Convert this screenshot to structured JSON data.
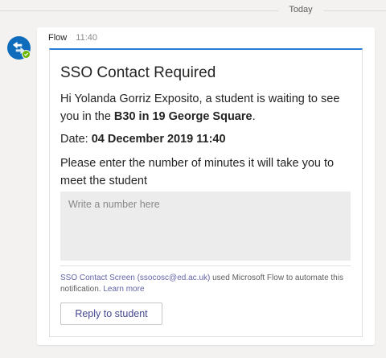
{
  "divider": {
    "label": "Today"
  },
  "message": {
    "sender": "Flow",
    "time": "11:40"
  },
  "card": {
    "title": "SSO Contact Required",
    "body_prefix": "Hi Yolanda Gorriz Exposito, a student is waiting to see you in the ",
    "body_location": "B30 in 19 George Square",
    "body_suffix": ".",
    "date_label": "Date: ",
    "date_value": "04 December 2019 11:40",
    "prompt": "Please enter the number of minutes it will take you to meet the student",
    "input_placeholder": "Write a number here",
    "footer_sender": "SSO Contact Screen (ssocosc@ed.ac.uk)",
    "footer_text": " used Microsoft Flow to automate this notification. ",
    "footer_link": "Learn more",
    "button_label": "Reply to student"
  },
  "colors": {
    "accent": "#2b7cd3",
    "avatar": "#0f6cbd",
    "badge": "#6bb700",
    "link": "#6264a7"
  },
  "icons": {
    "avatar": "flow-icon",
    "badge": "check-icon"
  }
}
